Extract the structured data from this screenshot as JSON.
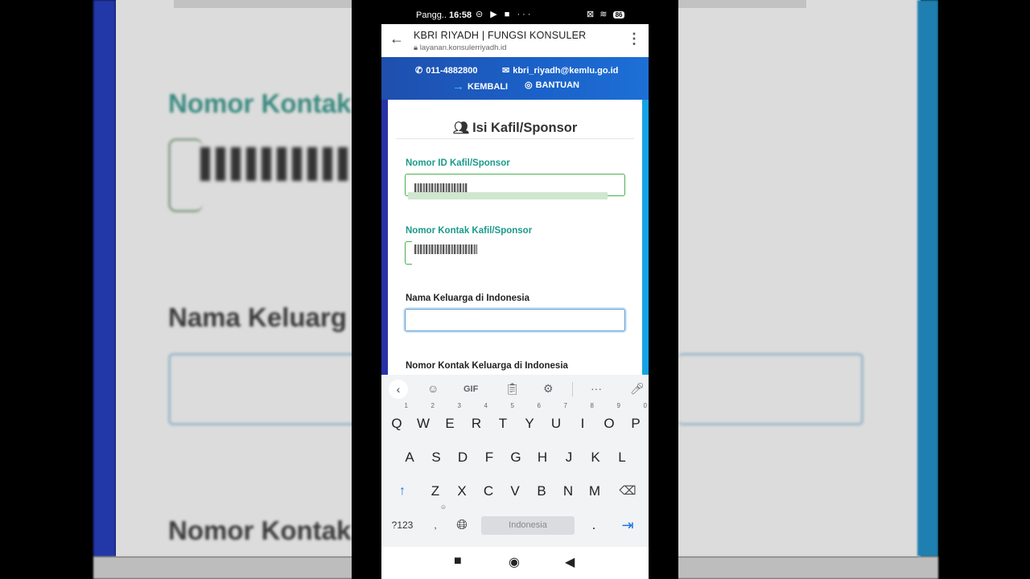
{
  "status_bar": {
    "carrier": "Pangg..",
    "time": "16:58",
    "left_icons": "⊝ ▶ ■ ···",
    "right_icons": "⊠ ≋",
    "battery": "86"
  },
  "browser": {
    "page_title": "KBRI RIYADH | FUNGSI KONSULER",
    "url": "layanan.konsulerriyadh.id"
  },
  "site_header": {
    "phone": "011-4882800",
    "email": "kbri_riyadh@kemlu.go.id",
    "back_label": "KEMBALI",
    "help_label": "BANTUAN"
  },
  "form": {
    "title": "Isi Kafil/Sponsor",
    "fields": [
      {
        "label": "Nomor ID Kafil/Sponsor",
        "value": ""
      },
      {
        "label": "Nomor Kontak Kafil/Sponsor",
        "value": ""
      },
      {
        "label": "Nama Keluarga di Indonesia",
        "value": ""
      },
      {
        "label": "Nomor Kontak Keluarga di Indonesia",
        "value": ""
      }
    ]
  },
  "keyboard": {
    "toolbar": {
      "gif": "GIF",
      "more": "···"
    },
    "row1": [
      "Q",
      "W",
      "E",
      "R",
      "T",
      "Y",
      "U",
      "I",
      "O",
      "P"
    ],
    "row1_hints": [
      "1",
      "2",
      "3",
      "4",
      "5",
      "6",
      "7",
      "8",
      "9",
      "0"
    ],
    "row2": [
      "A",
      "S",
      "D",
      "F",
      "G",
      "H",
      "J",
      "K",
      "L"
    ],
    "row3": [
      "Z",
      "X",
      "C",
      "V",
      "B",
      "N",
      "M"
    ],
    "symbols": "?123",
    "comma": ",",
    "space_label": "Indonesia",
    "period": "."
  },
  "background_zoom": {
    "label1": "Nomor Kontak",
    "label2": "Nama Keluarg",
    "label3": "Nomor Kontak"
  },
  "colors": {
    "header_blue": "#1a62c9",
    "teal_label": "#1a9a8c",
    "sidebar_blue": "#2733a6",
    "sidebar_cyan": "#16a2e6"
  }
}
